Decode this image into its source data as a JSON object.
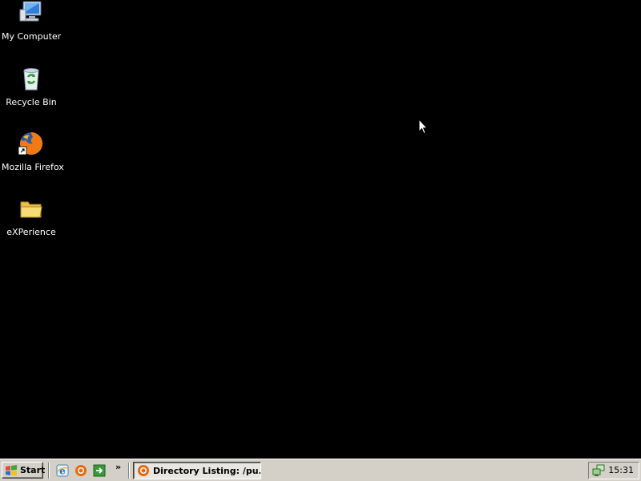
{
  "desktop": {
    "background": "#000000",
    "icons": [
      {
        "label": "My Computer",
        "icon": "my-computer-icon"
      },
      {
        "label": "Recycle Bin",
        "icon": "recycle-bin-icon"
      },
      {
        "label": "Mozilla Firefox",
        "icon": "firefox-icon"
      },
      {
        "label": "eXPerience",
        "icon": "folder-icon"
      }
    ]
  },
  "taskbar": {
    "start_label": "Start",
    "quick_launch": [
      {
        "icon": "internet-explorer-icon"
      },
      {
        "icon": "firefox-icon"
      },
      {
        "icon": "show-desktop-icon"
      }
    ],
    "chevron": "»",
    "tasks": [
      {
        "label": "Directory Listing: /pu...",
        "icon": "firefox-icon",
        "active": true
      }
    ],
    "tray": {
      "icons": [
        {
          "icon": "network-icon"
        }
      ],
      "clock": "15:31"
    }
  }
}
